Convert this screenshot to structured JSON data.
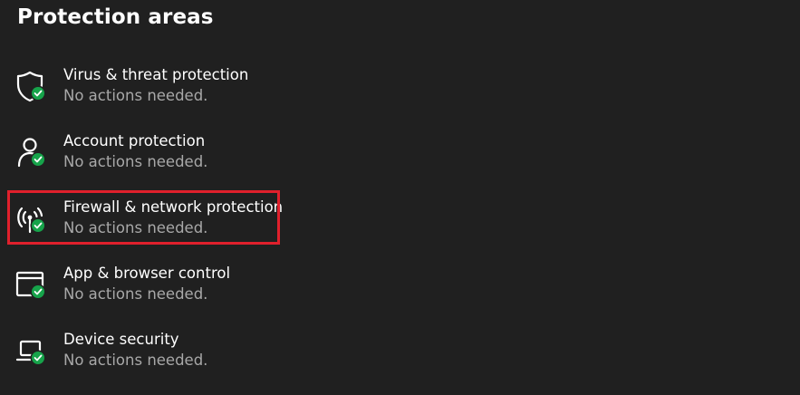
{
  "page": {
    "heading": "Protection areas"
  },
  "protection_areas": [
    {
      "title": "Virus & threat protection",
      "status": "No actions needed.",
      "icon": "shield-icon",
      "status_icon": "check-badge-icon"
    },
    {
      "title": "Account protection",
      "status": "No actions needed.",
      "icon": "person-icon",
      "status_icon": "check-badge-icon"
    },
    {
      "title": "Firewall & network protection",
      "status": "No actions needed.",
      "icon": "antenna-icon",
      "status_icon": "check-badge-icon",
      "highlighted": true
    },
    {
      "title": "App & browser control",
      "status": "No actions needed.",
      "icon": "browser-window-icon",
      "status_icon": "check-badge-icon"
    },
    {
      "title": "Device security",
      "status": "No actions needed.",
      "icon": "laptop-icon",
      "status_icon": "check-badge-icon"
    }
  ],
  "colors": {
    "background": "#202020",
    "text_primary": "#ffffff",
    "text_secondary": "#a8a8a8",
    "status_ok": "#16a34a",
    "highlight": "#e0202c"
  }
}
